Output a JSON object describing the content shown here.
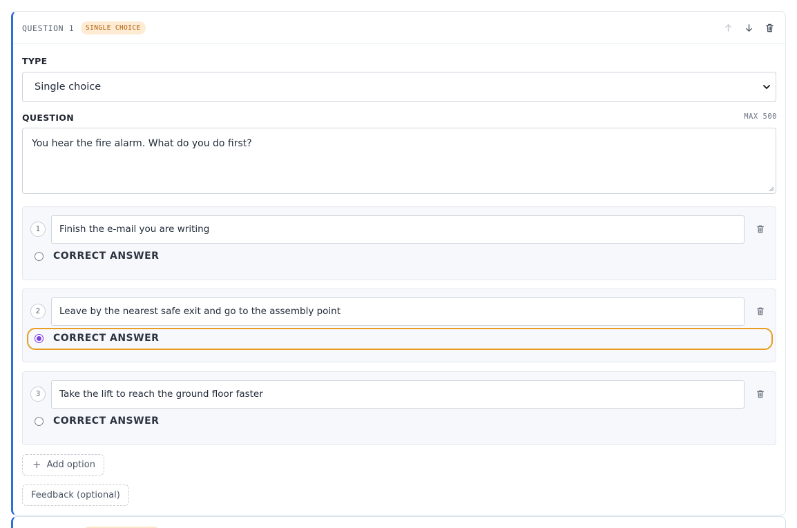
{
  "question": {
    "number_label": "QUESTION 1",
    "type_badge": "SINGLE CHOICE",
    "type_label": "TYPE",
    "type_value": "Single choice",
    "question_label": "QUESTION",
    "max_label": "MAX 500",
    "question_text": "You hear the fire alarm. What do you do first?"
  },
  "options": [
    {
      "number": "1",
      "text": "Finish the e-mail you are writing",
      "correct_label": "CORRECT ANSWER",
      "selected": false
    },
    {
      "number": "2",
      "text": "Leave by the nearest safe exit and go to the assembly point",
      "correct_label": "CORRECT ANSWER",
      "selected": true
    },
    {
      "number": "3",
      "text": "Take the lift to reach the ground floor faster",
      "correct_label": "CORRECT ANSWER",
      "selected": false
    }
  ],
  "actions": {
    "add_option_icon": "+",
    "add_option_label": "Add option",
    "feedback_label": "Feedback (optional)"
  },
  "icons": {
    "move_up": "arrow-up-icon",
    "move_down": "arrow-down-icon",
    "delete": "trash-icon",
    "dropdown": "chevron-down-icon"
  },
  "colors": {
    "accent_border": "#2f6fd6",
    "badge_bg": "#fdebd3",
    "badge_text": "#b45f06",
    "focus_ring": "#ea9c22",
    "radio_checked": "#7b3fe4"
  }
}
